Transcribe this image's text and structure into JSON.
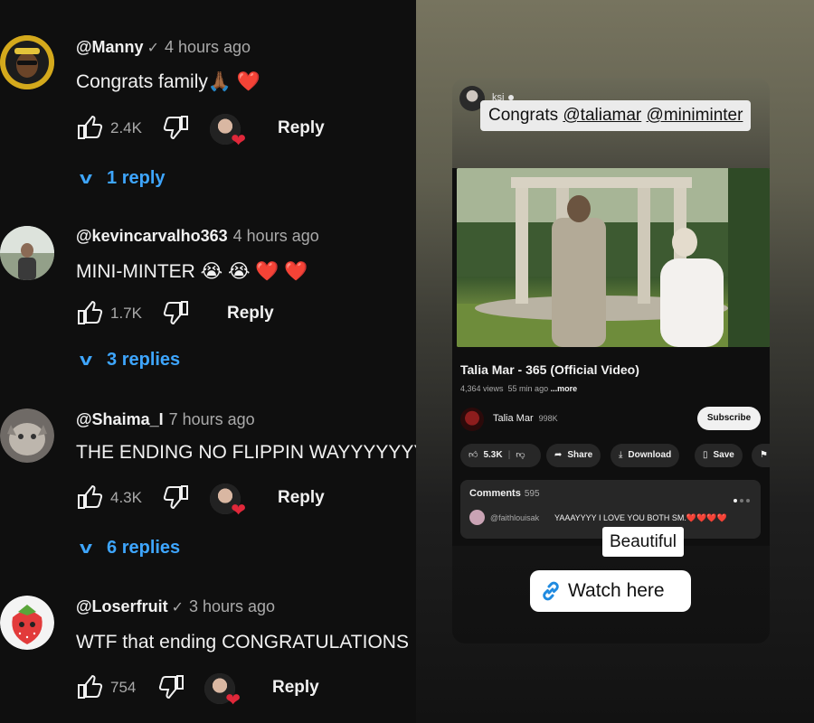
{
  "comments": [
    {
      "user": "@Manny",
      "verified": true,
      "time": "4 hours ago",
      "text": "Congrats family🙏🏾 ❤️",
      "likes": "2.4K",
      "reply": "Reply",
      "replies": "1 reply",
      "creator_heart": true
    },
    {
      "user": "@kevincarvalho363",
      "verified": false,
      "time": "4 hours ago",
      "text": "MINI-MINTER 😭 😭 ❤️ ❤️",
      "likes": "1.7K",
      "reply": "Reply",
      "replies": "3 replies",
      "creator_heart": false
    },
    {
      "user": "@Shaima_I",
      "verified": false,
      "time": "7 hours ago",
      "text": "THE ENDING NO FLIPPIN WAYYYYYYYY",
      "likes": "4.3K",
      "reply": "Reply",
      "replies": "6 replies",
      "creator_heart": true
    },
    {
      "user": "@Loserfruit",
      "verified": true,
      "time": "3 hours ago",
      "text": "WTF that ending CONGRATULATIONS",
      "likes": "754",
      "reply": "Reply",
      "replies": "",
      "creator_heart": true
    }
  ],
  "story": {
    "user": "ksi",
    "caption_prefix": "Congrats ",
    "mention1": "@taliamar",
    "mention2": "@miniminter",
    "video_title": "Talia Mar - 365 (Official Video)",
    "views": "4,364 views",
    "age": "55 min ago",
    "more": "...more",
    "channel": "Talia Mar",
    "subscribers": "998K",
    "subscribe": "Subscribe",
    "likes": "5.3K",
    "share": "Share",
    "download": "Download",
    "save": "Save",
    "comments_label": "Comments",
    "comments_count": "595",
    "top_comment_user": "@faithlouisak",
    "top_comment_text": "YAAAYYYY I LOVE YOU BOTH SM.❤️❤️❤️❤️",
    "sticker": "Beautiful",
    "link_label": "Watch here"
  },
  "colors": {
    "accent_blue": "#3ea6ff",
    "heart_red": "#e0283a",
    "background": "#0f0f0f"
  }
}
